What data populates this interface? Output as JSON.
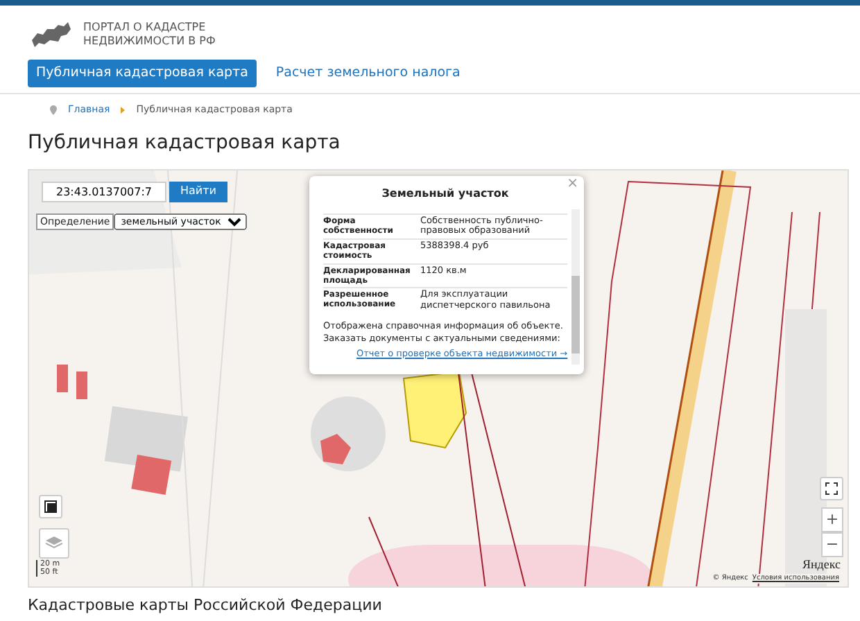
{
  "header": {
    "logo_line1": "ПОРТАЛ О КАДАСТРЕ",
    "logo_line2": "НЕДВИЖИМОСТИ В РФ"
  },
  "tabs": [
    {
      "label": "Публичная кадастровая карта",
      "selected": true
    },
    {
      "label": "Расчет земельного налога",
      "selected": false
    }
  ],
  "breadcrumb": [
    "Главная",
    "Публичная кадастровая карта"
  ],
  "page_title": "Публичная кадастровая карта",
  "map": {
    "search": {
      "value": "23:43.0137007:7",
      "button": "Найти"
    },
    "mode": {
      "label": "Определение",
      "value": "земельный участок"
    },
    "popup": {
      "title": "Земельный участок",
      "close": "×",
      "rows": [
        {
          "name": "Форма собственности",
          "value": "Собственность публично-правовых образований"
        },
        {
          "name": "Кадастровая стоимость",
          "value": "5388398.4 руб"
        },
        {
          "name": "Декларированная площадь",
          "value": "1120 кв.м"
        },
        {
          "name": "Разрешенное использование",
          "value": "Для эксплуатации диспетчерского павильона"
        }
      ],
      "note": "Отображена справочная информация об объекте. Заказать документы с актуальными сведениями:",
      "link": "Отчет о проверке объекта недвижимости →"
    },
    "scale": [
      "20 m",
      "50 ft"
    ],
    "zoom_in": "+",
    "zoom_out": "−",
    "logo": "Яндекс",
    "copyright": "© Яндекс",
    "terms": "Условия использования"
  },
  "section_title": "Кадастровые карты Российской Федерации"
}
